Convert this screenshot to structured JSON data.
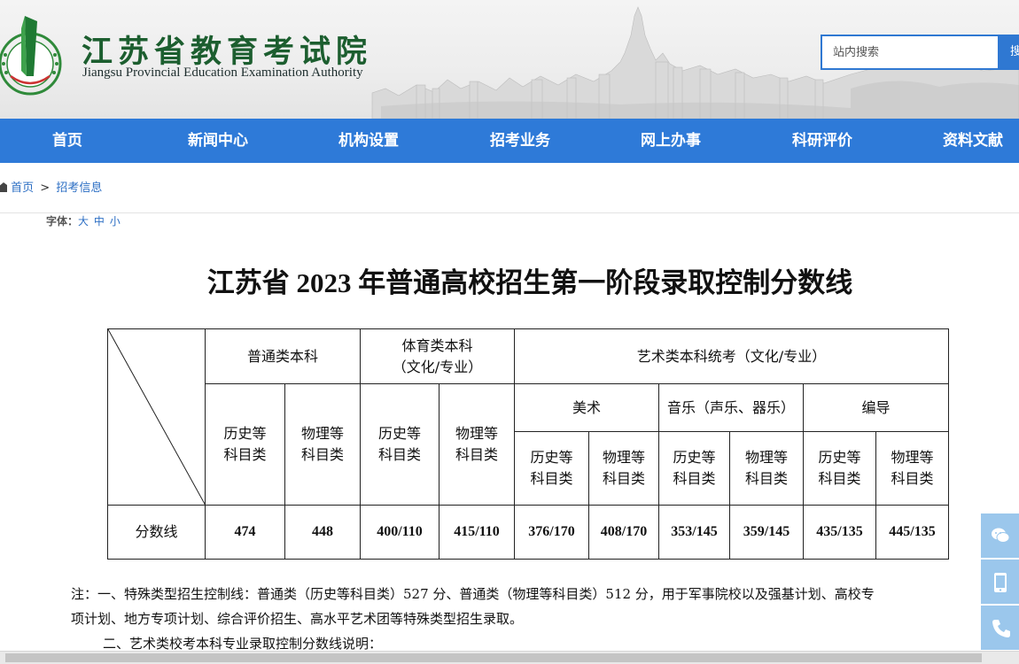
{
  "header": {
    "title": "江苏省教育考试院",
    "subtitle": "Jiangsu Provincial Education Examination Authority",
    "logo_ring_text": "江苏省教育考试院",
    "search": {
      "placeholder": "站内搜索",
      "button_label": "搜"
    }
  },
  "nav": [
    "首页",
    "新闻中心",
    "机构设置",
    "招考业务",
    "网上办事",
    "科研评价",
    "资料文献"
  ],
  "breadcrumb": {
    "home": "首页",
    "separator": ">",
    "current": "招考信息"
  },
  "font_size": {
    "label": "字体：",
    "options": [
      "大",
      "中",
      "小"
    ]
  },
  "article": {
    "title": "江苏省 2023 年普通高校招生第一阶段录取控制分数线",
    "table": {
      "groups": {
        "general": "普通类本科",
        "sports_line1": "体育类本科",
        "sports_line2": "（文化/专业）",
        "art": "艺术类本科统考（文化/专业）"
      },
      "art_subgroups": [
        "美术",
        "音乐（声乐、器乐）",
        "编导"
      ],
      "subject_history_l1": "历史等",
      "subject_history_l2": "科目类",
      "subject_physics_l1": "物理等",
      "subject_physics_l2": "科目类",
      "row_label": "分数线",
      "scores": [
        "474",
        "448",
        "400/110",
        "415/110",
        "376/170",
        "408/170",
        "353/145",
        "359/145",
        "435/135",
        "445/135"
      ]
    },
    "notes": {
      "line1": "注：一、特殊类型招生控制线：普通类（历史等科目类）527 分、普通类（物理等科目类）512 分，用于军事院校以及强基计划、高校专",
      "line2": "项计划、地方专项计划、综合评价招生、高水平艺术团等特殊类型招生录取。",
      "line3": "二、艺术类校考本科专业录取控制分数线说明："
    }
  },
  "float_tools": [
    "wechat-icon",
    "mobile-icon",
    "phone-icon"
  ],
  "colors": {
    "nav": "#2e7ad8",
    "title_green": "#1c5e2f",
    "float": "#9bc7ec"
  }
}
